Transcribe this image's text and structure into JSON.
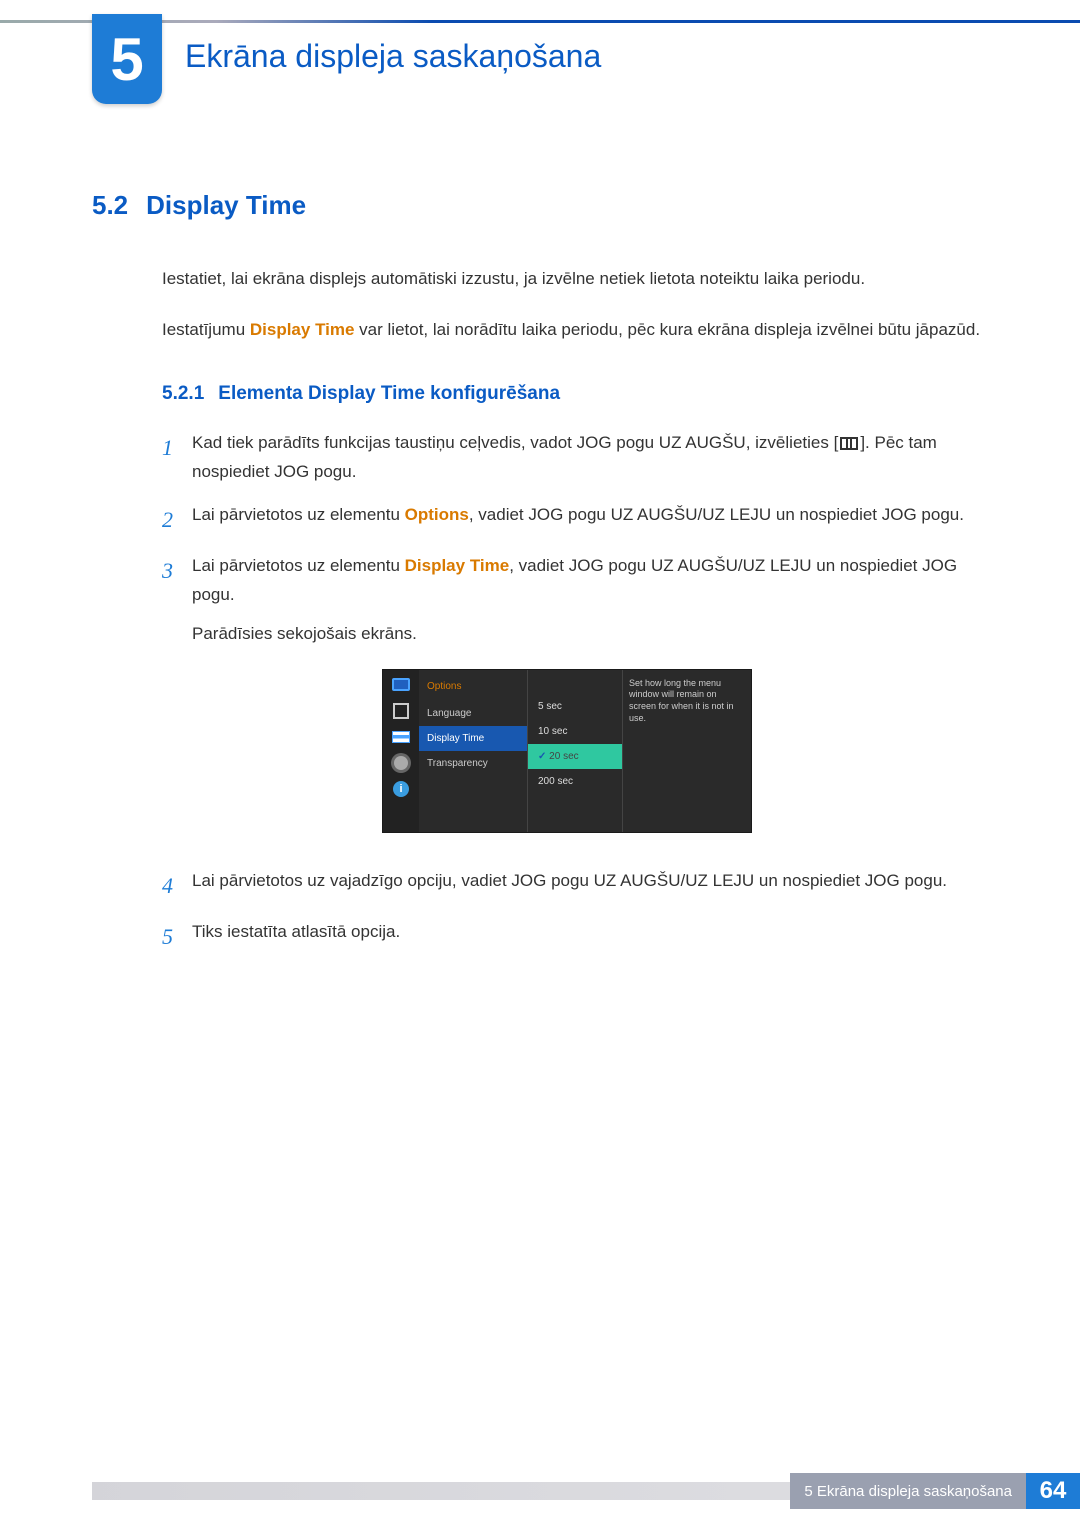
{
  "chapter": {
    "number": "5",
    "title": "Ekrāna displeja saskaņošana"
  },
  "section": {
    "number": "5.2",
    "title": "Display Time"
  },
  "intro1": "Iestatiet, lai ekrāna displejs automātiski izzustu, ja izvēlne netiek lietota noteiktu laika periodu.",
  "intro2a": "Iestatījumu ",
  "intro2_hl": "Display Time",
  "intro2b": " var lietot, lai norādītu laika periodu, pēc kura ekrāna displeja izvēlnei būtu jāpazūd.",
  "subsection": {
    "number": "5.2.1",
    "title": "Elementa Display Time konfigurēšana"
  },
  "steps": {
    "s1a": "Kad tiek parādīts funkcijas taustiņu ceļvedis, vadot JOG pogu UZ AUGŠU, izvēlieties [",
    "s1b": "]. Pēc tam nospiediet JOG pogu.",
    "s2a": "Lai pārvietotos uz elementu ",
    "s2_hl": "Options",
    "s2b": ", vadiet JOG pogu UZ AUGŠU/UZ LEJU un nospiediet JOG pogu.",
    "s3a": "Lai pārvietotos uz elementu ",
    "s3_hl": "Display Time",
    "s3b": ", vadiet JOG pogu UZ AUGŠU/UZ LEJU un nospiediet JOG pogu.",
    "s3c": "Parādīsies sekojošais ekrāns.",
    "s4": "Lai pārvietotos uz vajadzīgo opciju, vadiet JOG pogu UZ AUGŠU/UZ LEJU un nospiediet JOG pogu.",
    "s5": "Tiks iestatīta atlasītā opcija."
  },
  "step_numbers": {
    "n1": "1",
    "n2": "2",
    "n3": "3",
    "n4": "4",
    "n5": "5"
  },
  "osd": {
    "title": "Options",
    "menu": [
      "Language",
      "Display Time",
      "Transparency"
    ],
    "options": [
      "5 sec",
      "10 sec",
      "20 sec",
      "200 sec"
    ],
    "desc": "Set how long the menu window will remain on screen for when it is not in use.",
    "info_glyph": "i"
  },
  "footer": {
    "label": "5 Ekrāna displeja saskaņošana",
    "page": "64"
  }
}
